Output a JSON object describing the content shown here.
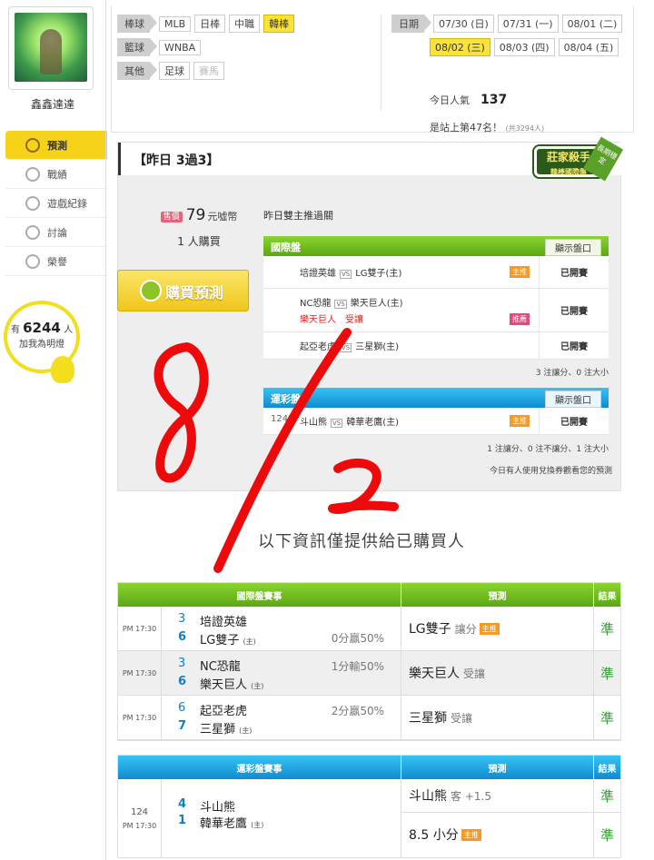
{
  "sidebar": {
    "username": "鑫鑫達達",
    "nav": [
      {
        "label": "預測",
        "active": true
      },
      {
        "label": "戰績"
      },
      {
        "label": "遊戲紀錄"
      },
      {
        "label": "討論"
      },
      {
        "label": "榮譽"
      }
    ],
    "fans": {
      "pre": "有",
      "count": "6244",
      "unit": "人",
      "caption": "加我為明燈"
    }
  },
  "header": {
    "rows": [
      {
        "cat": "棒球",
        "chips": [
          "MLB",
          "日棒",
          "中職",
          "韓棒"
        ],
        "active": "韓棒"
      },
      {
        "cat": "籃球",
        "chips": [
          "WNBA"
        ]
      },
      {
        "cat": "其他",
        "chips": [
          "足球",
          "賽馬"
        ]
      }
    ],
    "date_label": "日期",
    "dates1": [
      "07/30 (日)",
      "07/31 (一)",
      "08/01 (二)"
    ],
    "dates2": [
      "08/02 (三)",
      "08/03 (四)",
      "08/04 (五)"
    ],
    "active_date": "08/02 (三)",
    "popularity_label": "今日人氣",
    "popularity": "137",
    "rank_text": "是站上第47名！",
    "rank_sub": "(共3294人)"
  },
  "main": {
    "record": "【昨日 3過3】",
    "badge": {
      "title": "莊家殺手",
      "sub": "韓棒國際盤",
      "ribbon": "長期穩定"
    },
    "price_tag": "售價",
    "price": "79",
    "price_unit": "元噓幣",
    "buyers": "1 人購買",
    "buy_label": "購買預測",
    "title": "昨日雙主推過關",
    "intl": {
      "header": "國際盤",
      "button": "顯示盤口",
      "rows": [
        {
          "home": "培證英雄",
          "away": "LG雙子(主)",
          "tag": "主推",
          "status": "已開賽"
        },
        {
          "home": "NC恐龍",
          "away": "樂天巨人(主)",
          "pick": "樂天巨人",
          "pick2": "受讓",
          "tag": "推薦",
          "status": "已開賽"
        },
        {
          "home": "起亞老虎",
          "away": "三星獅(主)",
          "status": "已開賽"
        }
      ],
      "note": "3 注讓分、0 注大小"
    },
    "lottery": {
      "header": "運彩盤",
      "button": "顯示盤口",
      "rows": [
        {
          "no": "124",
          "home": "斗山熊",
          "away": "韓華老鷹(主)",
          "tag": "主推",
          "status": "已開賽"
        }
      ],
      "note": "1 注讓分、0 注不讓分、1 注大小"
    },
    "coupon_note": "今日有人使用兌換券觀看您的預測"
  },
  "info_text": "以下資訊僅提供給已購買人",
  "annotation": "8/2",
  "intl_table": {
    "headers": [
      "國際盤賽事",
      "預測",
      "結果"
    ],
    "rows": [
      {
        "time": "PM 17:30",
        "s1": "3",
        "t1": "培證英雄",
        "s2": "6",
        "t2": "LG雙子",
        "home": "(主)",
        "res": "0分贏50%",
        "pick": "LG雙子",
        "sub": "讓分",
        "tag": "主推",
        "result": "準"
      },
      {
        "time": "PM 17:30",
        "s1": "3",
        "t1": "NC恐龍",
        "s2": "6",
        "t2": "樂天巨人",
        "home": "(主)",
        "res": "1分輸50%",
        "pick": "樂天巨人",
        "sub": "受讓",
        "result": "準"
      },
      {
        "time": "PM 17:30",
        "s1": "6",
        "t1": "起亞老虎",
        "s2": "7",
        "t2": "三星獅",
        "home": "(主)",
        "res": "2分贏50%",
        "pick": "三星獅",
        "sub": "受讓",
        "result": "準"
      }
    ]
  },
  "lottery_table": {
    "headers": [
      "運彩盤賽事",
      "預測",
      "結果"
    ],
    "row": {
      "no": "124",
      "time": "PM 17:30",
      "s1": "4",
      "t1": "斗山熊",
      "s2": "1",
      "t2": "韓華老鷹",
      "home": "(主)",
      "pick1": "斗山熊",
      "sub1": "客 +1.5",
      "result1": "準",
      "pick2": "8.5 小分",
      "tag2": "主推",
      "result2": "準"
    }
  }
}
